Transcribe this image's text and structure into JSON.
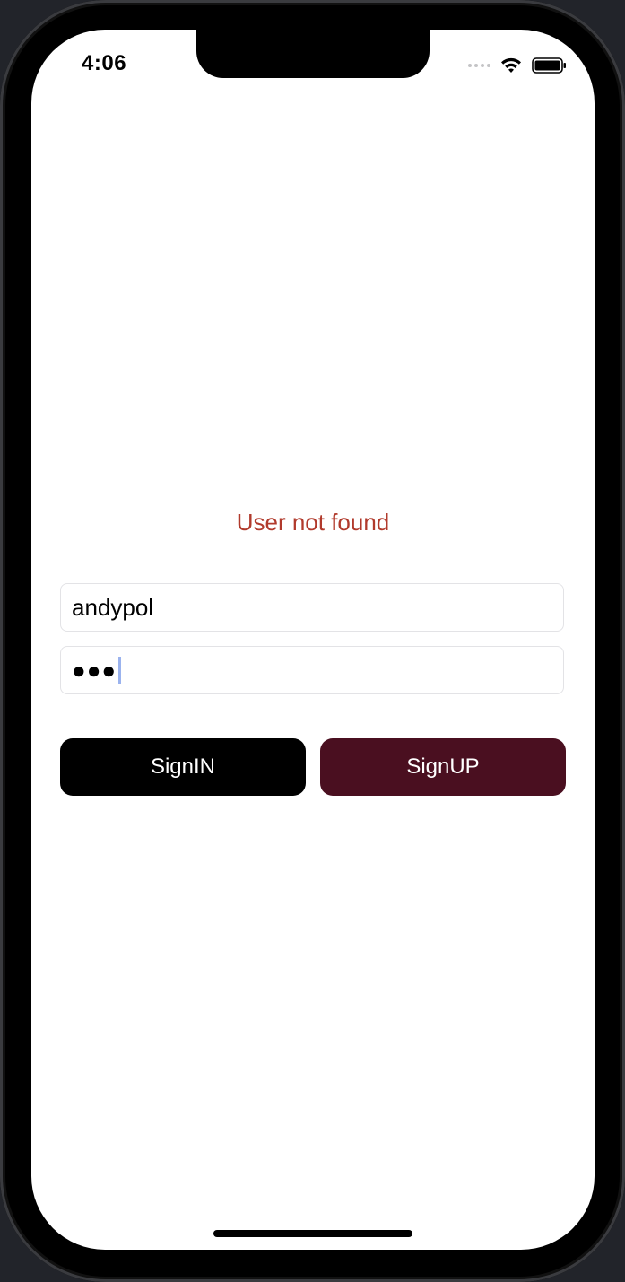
{
  "status_bar": {
    "time": "4:06",
    "icons": [
      "signal-icon",
      "wifi-icon",
      "battery-icon"
    ]
  },
  "login": {
    "error_message": "User not found",
    "username_value": "andypol",
    "password_mask": "●●●",
    "signin_label": "SignIN",
    "signup_label": "SignUP"
  },
  "colors": {
    "error": "#b13a2c",
    "signin_bg": "#000000",
    "signup_bg": "#4a0f20",
    "caret": "#9bb3ee"
  }
}
